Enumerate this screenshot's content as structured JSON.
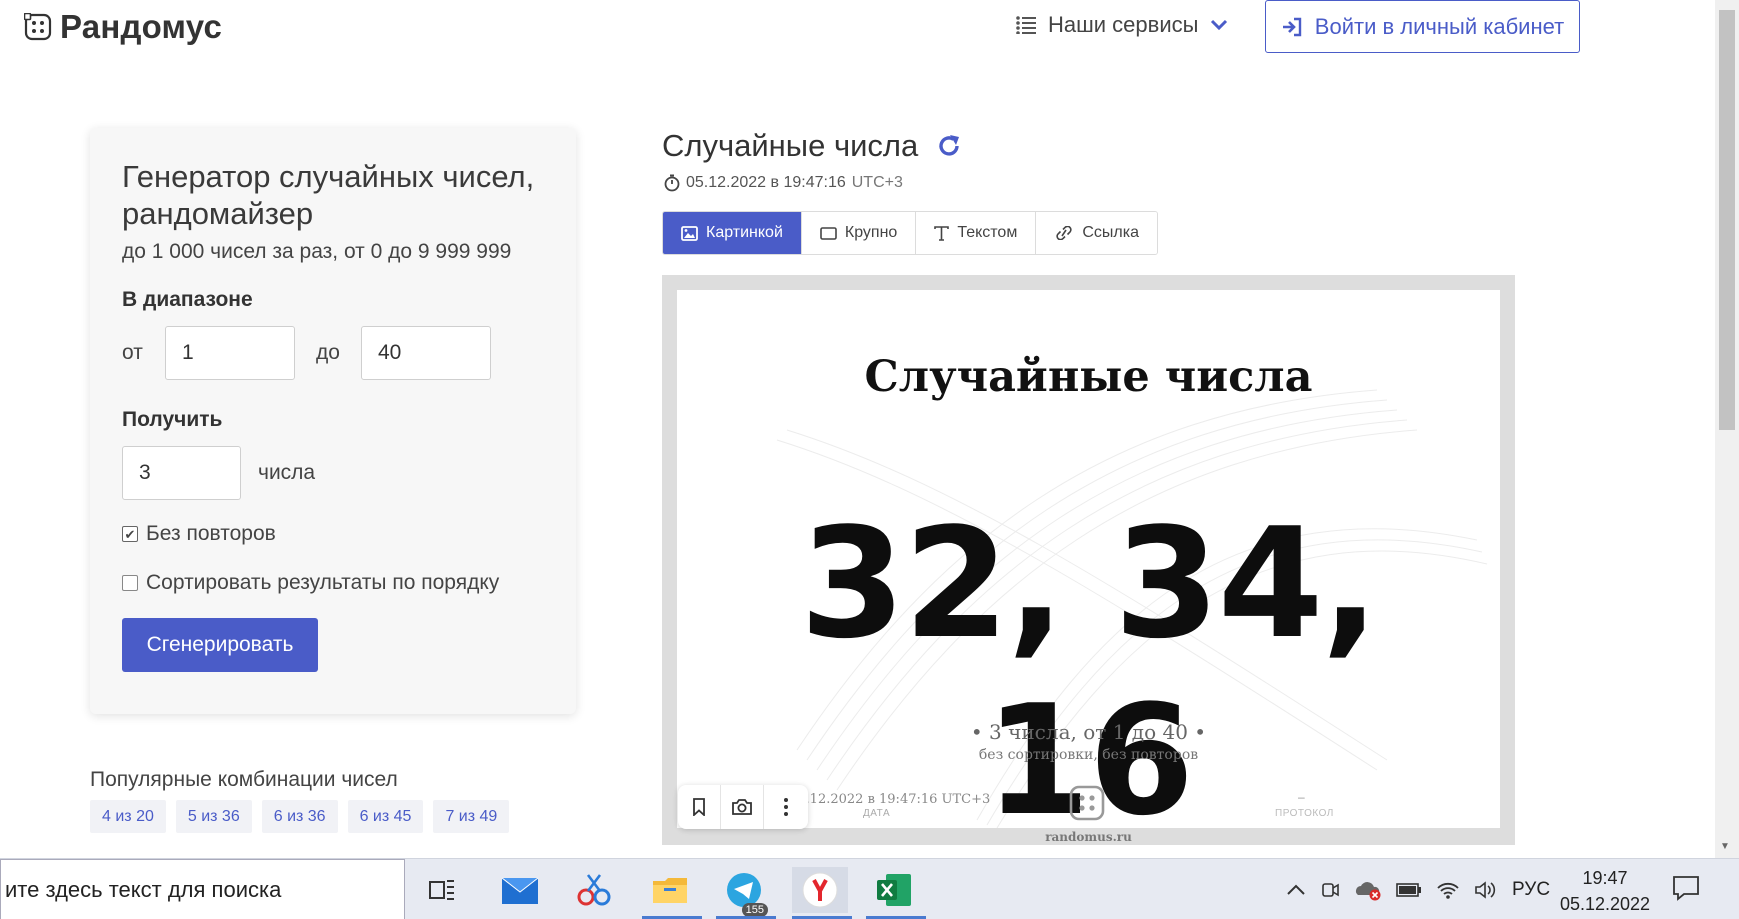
{
  "header": {
    "brand": "Рандомус",
    "services_label": "Наши сервисы",
    "login_label": "Войти в личный кабинет"
  },
  "generator": {
    "title": "Генератор случайных чисел, рандомайзер",
    "subtitle": "до 1 000 чисел за раз, от 0 до 9 999 999",
    "range_label": "В диапазоне",
    "from_label": "от",
    "from_value": "1",
    "to_label": "до",
    "to_value": "40",
    "get_label": "Получить",
    "count_value": "3",
    "count_unit": "числа",
    "no_repeat_label": "Без повторов",
    "no_repeat_checked": true,
    "sort_label": "Сортировать результаты по порядку",
    "sort_checked": false,
    "generate_label": "Сгенерировать"
  },
  "popular": {
    "title": "Популярные комбинации чисел",
    "tags": [
      "4 из 20",
      "5 из 36",
      "6 из 36",
      "6 из 45",
      "7 из 49"
    ]
  },
  "result": {
    "title": "Случайные числа",
    "timestamp": "05.12.2022 в 19:47:16",
    "timezone": "UTC+3",
    "tabs": [
      "Картинкой",
      "Крупно",
      "Текстом",
      "Ссылка"
    ],
    "active_tab": "Картинкой",
    "card": {
      "title": "Случайные числа",
      "numbers": "32, 34, 16",
      "summary": "• 3 числа, от 1 до 40 •",
      "details": "без сортировки, без повторов",
      "date": "05.12.2022 в 19:47:16 UTC+3",
      "date_label": "ДАТА",
      "site": "randomus.ru",
      "protocol_value": "–",
      "protocol_label": "ПРОТОКОЛ"
    }
  },
  "taskbar": {
    "search_text": "ите здесь текст для поиска",
    "telegram_badge": "155",
    "language": "РУС",
    "time": "19:47",
    "date": "05.12.2022"
  },
  "colors": {
    "accent": "#4a5cc8",
    "panel_bg": "#f7f7f7"
  }
}
